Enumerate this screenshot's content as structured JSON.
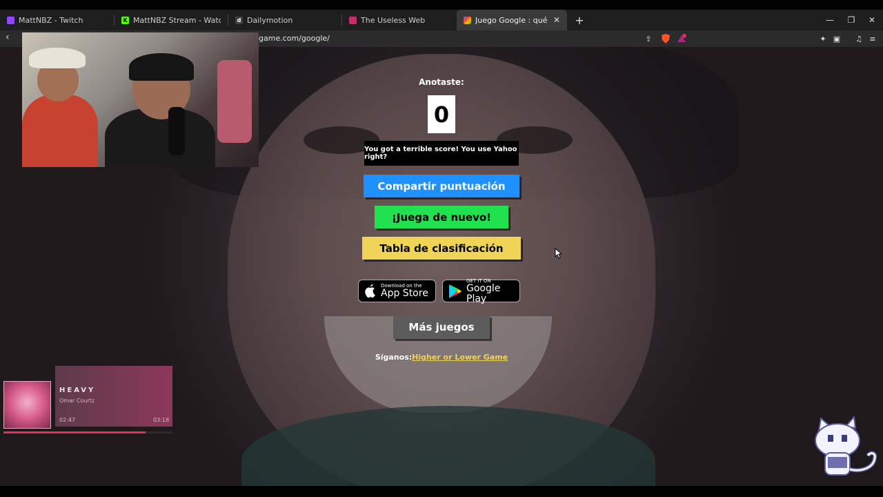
{
  "browser": {
    "tabs": [
      {
        "label": "MattNBZ - Twitch",
        "icon_color": "#9146ff",
        "active": false
      },
      {
        "label": "MattNBZ Stream - Watch Live on Kick",
        "icon_color": "#53fc18",
        "active": false
      },
      {
        "label": "Dailymotion",
        "icon_color": "#404040",
        "active": false
      },
      {
        "label": "The Useless Web",
        "icon_color": "#c0306a",
        "active": false
      },
      {
        "label": "Juego Google : qué hace que Google",
        "icon_color": "#e94235",
        "active": true
      }
    ],
    "new_tab_symbol": "+",
    "url": "game.com/google/",
    "shield_badge": "1"
  },
  "game": {
    "score_label": "Anotaste:",
    "score": "0",
    "message": "You got a terrible score! You use Yahoo right?",
    "share_label": "Compartir puntuación",
    "play_again_label": "¡Juega de nuevo!",
    "leaderboard_label": "Tabla de clasificación",
    "app_store": {
      "small": "Download on the",
      "big": "App Store"
    },
    "google_play": {
      "small": "GET IT ON",
      "big": "Google Play"
    },
    "more_games_label": "Más juegos",
    "follow_prefix": "Síganos:",
    "follow_link": "Higher or Lower Game"
  },
  "colors": {
    "share": "#1e90ff",
    "play_again": "#21e24e",
    "leaderboard": "#efd456",
    "more_games": "#5c5c5c"
  },
  "music": {
    "title": "HEAVY",
    "artist": "Omar Courtz",
    "current_time": "02:47",
    "total_time": "03:18",
    "progress_fraction": 0.84
  }
}
